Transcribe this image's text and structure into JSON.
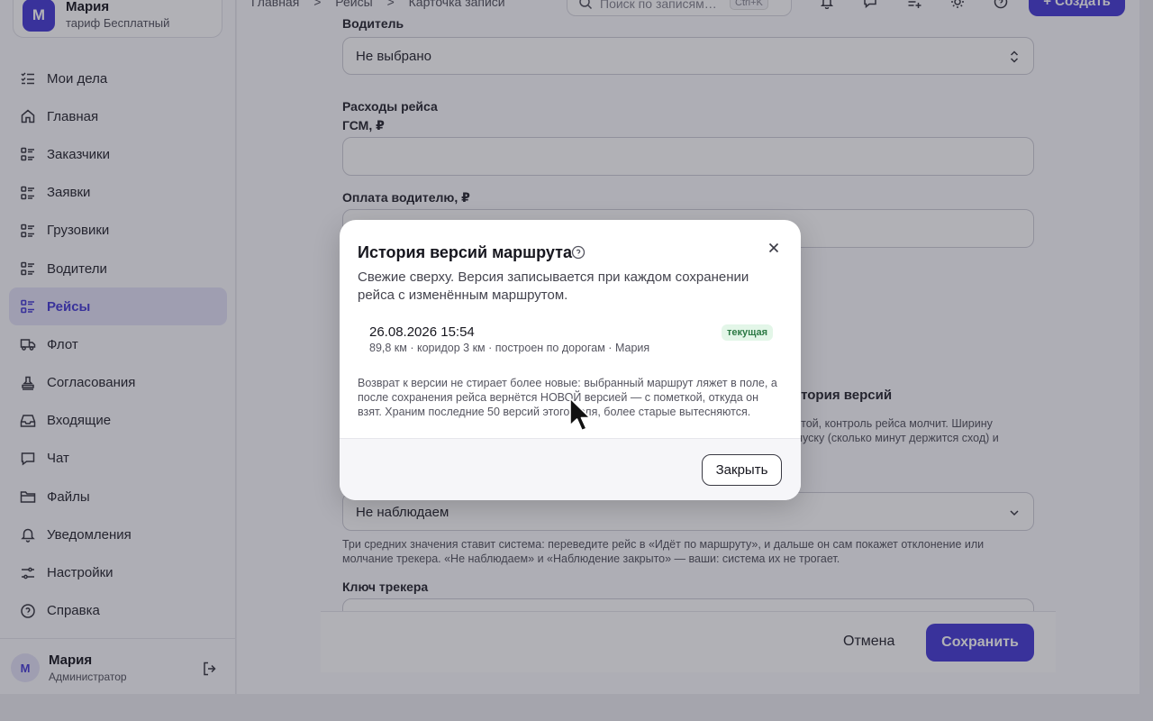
{
  "org": {
    "avatar": "М",
    "name": "Мария",
    "plan": "тариф Бесплатный"
  },
  "nav": [
    {
      "label": "Мои дела",
      "icon": "list-check-icon"
    },
    {
      "label": "Главная",
      "icon": "home-icon"
    },
    {
      "label": "Заказчики",
      "icon": "list-icon"
    },
    {
      "label": "Заявки",
      "icon": "list-icon"
    },
    {
      "label": "Грузовики",
      "icon": "list-icon"
    },
    {
      "label": "Водители",
      "icon": "list-icon"
    },
    {
      "label": "Рейсы",
      "icon": "list-icon",
      "active": true
    },
    {
      "label": "Флот",
      "icon": "truck-icon"
    },
    {
      "label": "Согласования",
      "icon": "stamp-icon"
    },
    {
      "label": "Входящие",
      "icon": "inbox-icon"
    },
    {
      "label": "Чат",
      "icon": "chat-icon"
    },
    {
      "label": "Файлы",
      "icon": "folder-icon"
    },
    {
      "label": "Уведомления",
      "icon": "bell-icon"
    },
    {
      "label": "Настройки",
      "icon": "sliders-icon"
    },
    {
      "label": "Справка",
      "icon": "help-icon"
    }
  ],
  "user": {
    "avatar": "М",
    "name": "Мария",
    "role": "Администратор"
  },
  "breadcrumbs": [
    "Главная",
    ">",
    "Рейсы",
    ">",
    "Карточка записи"
  ],
  "search": {
    "placeholder": "Поиск по записям…",
    "shortcut": "Ctrl+K"
  },
  "create_label": "+ Создать",
  "form": {
    "driver_label": "Водитель",
    "driver_value": "Не выбрано",
    "expenses_heading": "Расходы рейса",
    "fuel_label": "ГСМ, ₽",
    "pay_label": "Оплата водителю, ₽",
    "history_link": "История версий",
    "corridor_hint_1": "пустой, контроль рейса молчит. Ширину",
    "corridor_hint_2": "допуску (сколько минут держится сход) и",
    "monitoring_value": "Не наблюдаем",
    "monitoring_hint": "Три средних значения ставит система: переведите рейс в «Идёт по маршруту», и дальше он сам покажет отклонение или молчание трекера. «Не наблюдаем» и «Наблюдение закрыто» — ваши: система их не трогает.",
    "tracker_label": "Ключ трекера"
  },
  "footer": {
    "cancel": "Отмена",
    "save": "Сохранить"
  },
  "modal": {
    "title": "История версий маршрута",
    "description": "Свежие сверху. Версия записывается при каждом сохранении рейса с изменённым маршрутом.",
    "versions": [
      {
        "date": "26.08.2026 15:54",
        "meta": "89,8 км · коридор 3 км · построен по дорогам · Мария",
        "badge": "текущая"
      }
    ],
    "note": "Возврат к версии не стирает более новые: выбранный маршрут ляжет в поле, а после сохранения рейса вернётся НОВОЙ версией — с пометкой, откуда он взят. Храним последние 50 версий этого поля, более старые вытесняются.",
    "close_label": "Закрыть"
  },
  "colors": {
    "accent": "#4a3fd6",
    "badge_bg": "#e3f6e8",
    "badge_text": "#2c7a45"
  }
}
